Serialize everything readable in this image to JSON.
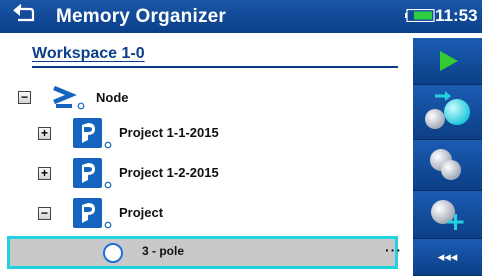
{
  "header": {
    "title": "Memory Organizer",
    "time": "11:53",
    "back_icon": "back-arrow-icon",
    "battery_icon": "battery-icon"
  },
  "workspace": {
    "title": "Workspace 1-0"
  },
  "tree": {
    "node": {
      "label": "Node",
      "icon": "node-prompt-icon",
      "expander": "−"
    },
    "items": [
      {
        "label": "Project 1-1-2015",
        "expander": "+",
        "icon": "project-icon"
      },
      {
        "label": "Project 1-2-2015",
        "expander": "+",
        "icon": "project-icon"
      },
      {
        "label": "Project",
        "expander": "−",
        "icon": "project-icon"
      }
    ],
    "selected": {
      "label": "3 - pole",
      "icon": "measurement-circle-icon",
      "more": "···"
    }
  },
  "sidebar": {
    "buttons": [
      {
        "name": "start-test",
        "icon": "play-icon"
      },
      {
        "name": "move-item",
        "icon": "move-icon"
      },
      {
        "name": "clone-item",
        "icon": "clone-icon"
      },
      {
        "name": "add-item",
        "icon": "add-icon"
      }
    ],
    "more_label": "◂◂◂"
  },
  "colors": {
    "header": "#0b3f8a",
    "selection_border": "#22d3df",
    "play": "#33cc33"
  }
}
